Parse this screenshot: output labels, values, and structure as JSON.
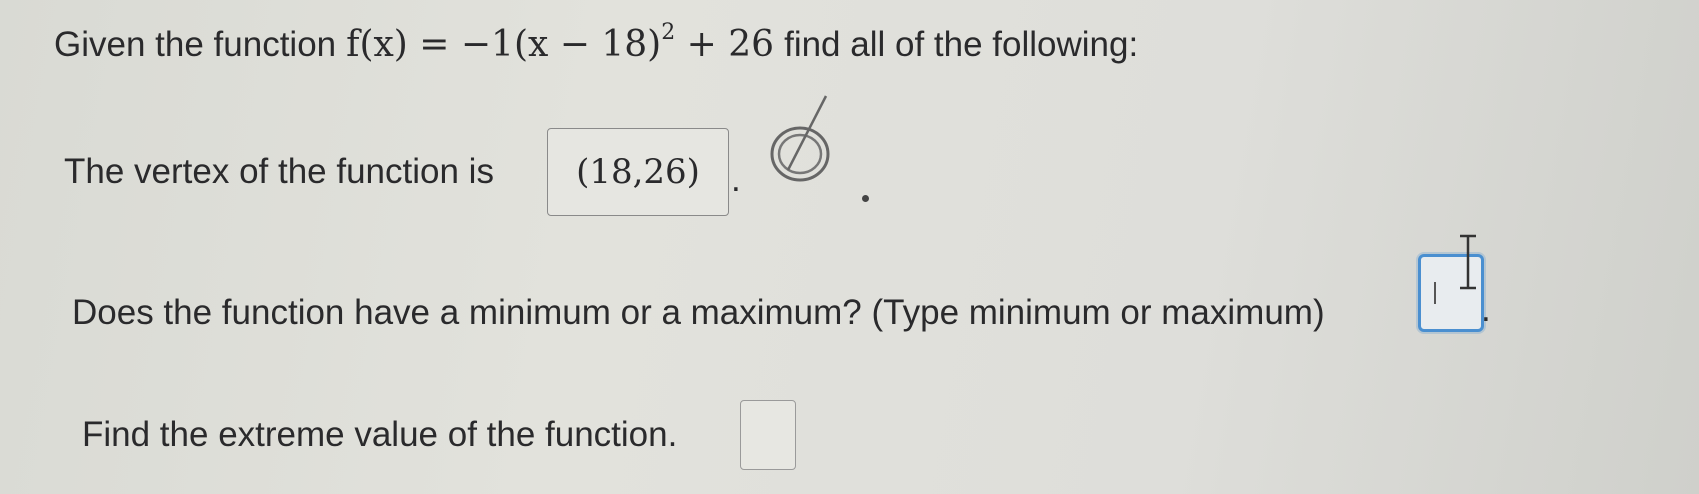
{
  "question": {
    "intro_before": "Given the function",
    "function_prefix": "f(x) = −1(x − 18)",
    "function_exponent": "2",
    "function_suffix": "+ 26",
    "intro_after": "find all of the following:"
  },
  "vertex": {
    "prompt": "The vertex of the function is",
    "answer": "(18,26)",
    "period": "."
  },
  "min_max": {
    "prompt": "Does the function have a minimum or a maximum? (Type minimum or maximum)",
    "answer": "",
    "period": "."
  },
  "extreme": {
    "prompt": "Find the extreme value of the function.",
    "answer": ""
  },
  "icons": {
    "preview": "preview-icon",
    "cursor": "text-cursor-icon"
  },
  "colors": {
    "focus_border": "#4a8fd0",
    "background": "#dcdcd6",
    "text": "#2a2a2c"
  }
}
